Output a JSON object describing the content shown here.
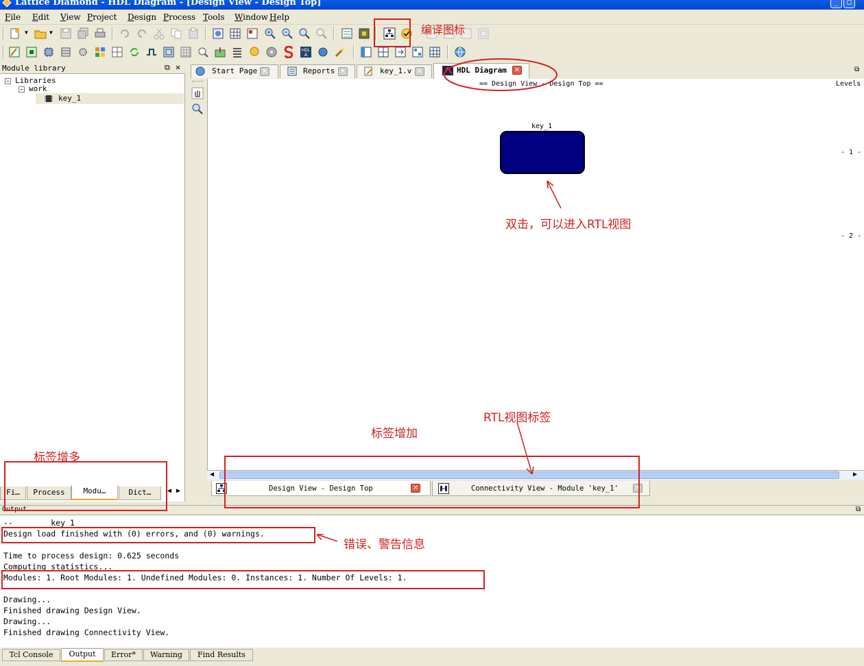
{
  "window": {
    "title": "Lattice Diamond - HDL Diagram - [Design View - Design Top]"
  },
  "menu": [
    "File",
    "Edit",
    "View",
    "Project",
    "Design",
    "Process",
    "Tools",
    "Window",
    "Help"
  ],
  "left_panel": {
    "header": "Module library",
    "tree": {
      "root": "Libraries",
      "lib": "work",
      "module": "key_1"
    },
    "tabs": [
      "Fi…",
      "Process",
      "Modu…",
      "Dict…"
    ]
  },
  "editor_tabs": [
    "Start Page",
    "Reports",
    "key_1.v",
    "HDL Diagram"
  ],
  "canvas": {
    "header": "== Design View - Design Top ==",
    "levels_label": "Levels",
    "level_marks": [
      "- 1 -",
      "- 2 -"
    ],
    "module_label": "key_1",
    "module_color": "#000080"
  },
  "view_tabs": [
    "Design View - Design Top",
    "Connectivity View - Module 'key_1'"
  ],
  "annotations": {
    "compile_icon": "编译图标",
    "double_click": "双击，可以进入RTL视图",
    "rtl_tab": "RTL视图标签",
    "tabs_added": "标签增加",
    "tabs_more": "标签增多",
    "err_warn": "错误、警告信息"
  },
  "output": {
    "header": "Output",
    "lines": [
      "--        key 1",
      "Design load finished with (0) errors, and (0) warnings.",
      "",
      "Time to process design: 0.625 seconds",
      "Computing statistics...",
      "Modules: 1. Root Modules: 1. Undefined Modules: 0. Instances: 1. Number Of Levels: 1.",
      "",
      "Drawing...",
      "Finished drawing Design View.",
      "Drawing...",
      "Finished drawing Connectivity View."
    ]
  },
  "bottom_tabs": [
    "Tcl Console",
    "Output",
    "Error*",
    "Warning",
    "Find Results"
  ],
  "colors": {
    "annotation": "#d42020",
    "titlebar": "#0054e3"
  }
}
